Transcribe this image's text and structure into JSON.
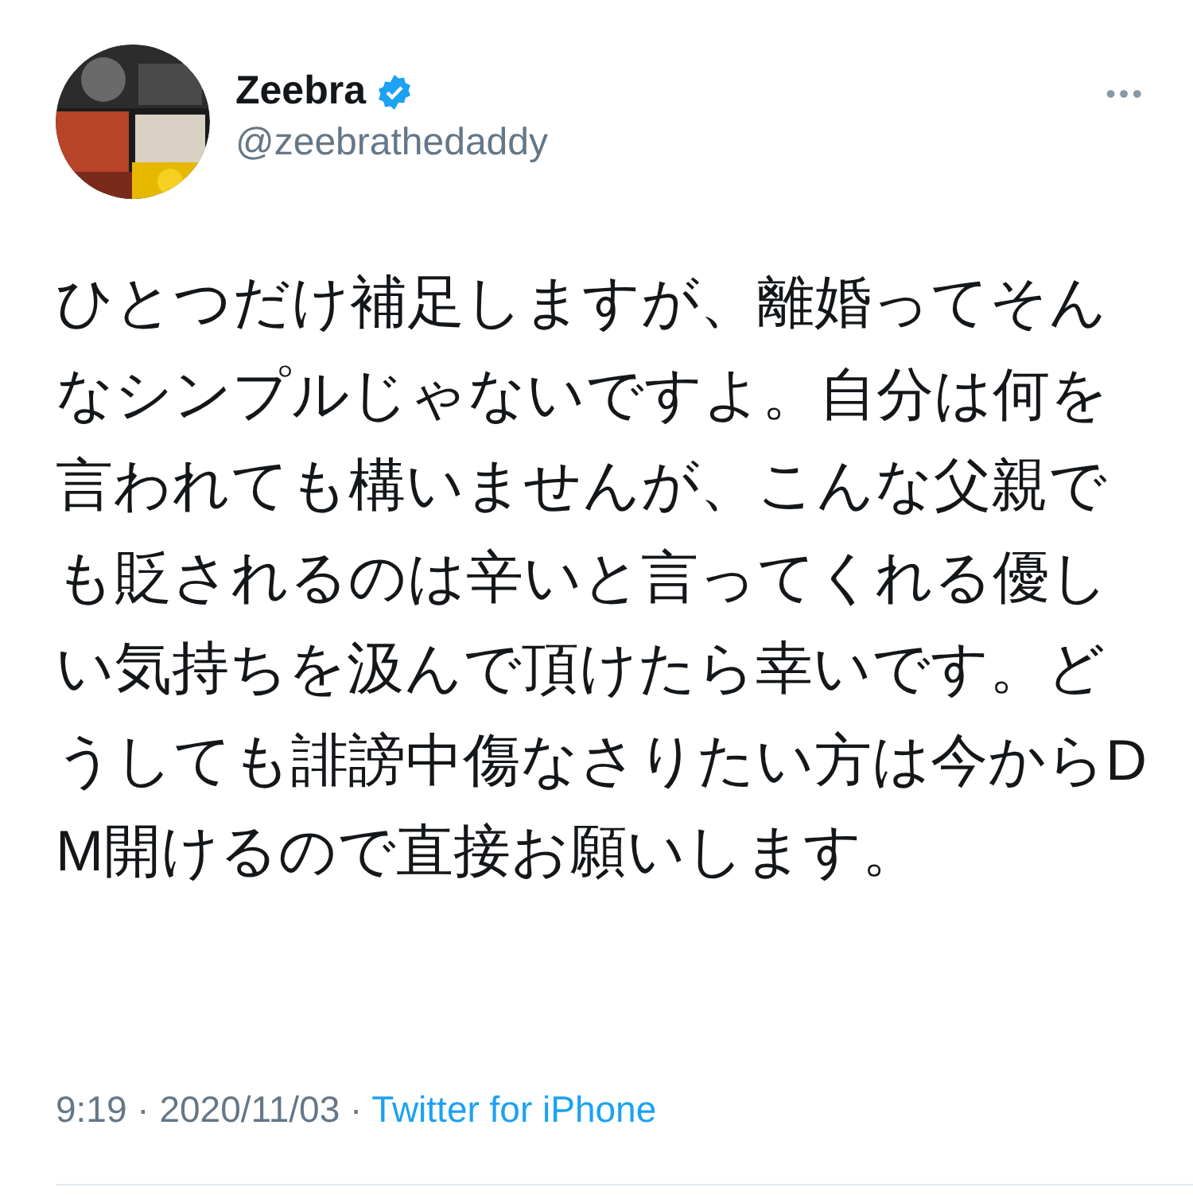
{
  "author": {
    "name": "Zeebra",
    "verified": true,
    "handle": "@zeebrathedaddy"
  },
  "more_menu": "•••",
  "text": "ひとつだけ補足しますが、離婚ってそんなシンプルじゃないですよ。自分は何を言われても構いませんが、こんな父親でも貶されるのは辛いと言ってくれる優しい気持ちを汲んで頂けたら幸いです。どうしても誹謗中傷なさりたい方は今からDM開けるので直接お願いします。",
  "timestamp": "9:19 · 2020/11/03 ·",
  "source": "Twitter for iPhone"
}
